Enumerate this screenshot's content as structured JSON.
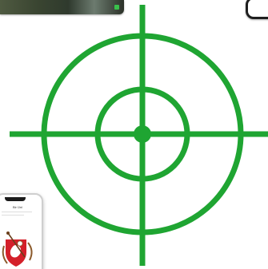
{
  "colors": {
    "crosshair": "#1fa532",
    "photo_accent": "#39c04b",
    "device_frame": "#1f1f1f",
    "shield_red": "#d4202a"
  },
  "icons": {
    "target": "crosshair-target-icon",
    "phone": "phone-mockup",
    "device": "device-frame-corner",
    "photo": "photo-thumbnail"
  },
  "phone_screen": {
    "title": "Bir Ünl"
  }
}
